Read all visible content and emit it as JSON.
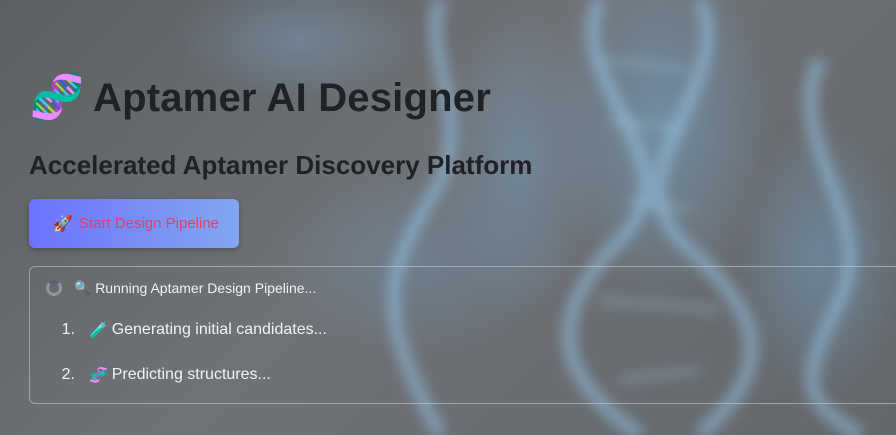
{
  "header": {
    "icon": "dna-icon",
    "icon_glyph": "🧬",
    "title": "Aptamer AI Designer",
    "subtitle": "Accelerated Aptamer Discovery Platform"
  },
  "start_button": {
    "icon": "rocket-icon",
    "icon_glyph": "🚀",
    "label": "Start Design Pipeline"
  },
  "status": {
    "spinner": "spinner-icon",
    "icon": "magnifier-icon",
    "icon_glyph": "🔍",
    "text": "Running Aptamer Design Pipeline..."
  },
  "steps": [
    {
      "number": "1.",
      "icon": "test-tube-icon",
      "icon_glyph": "🧪",
      "text": "Generating initial candidates..."
    },
    {
      "number": "2.",
      "icon": "dna-icon",
      "icon_glyph": "🧬",
      "text": "Predicting structures..."
    }
  ],
  "colors": {
    "button_gradient_start": "#6c72ff",
    "button_gradient_end": "#80a7f0",
    "button_label": "#e2406a",
    "heading_text": "#1f2125",
    "body_text": "#f1f2f4"
  }
}
